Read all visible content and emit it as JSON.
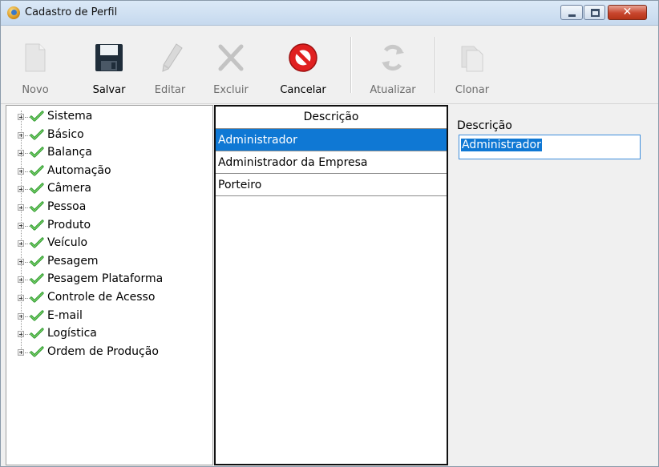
{
  "window": {
    "title": "Cadastro de Perfil",
    "close_glyph": "✕",
    "accent": "#0f78d4"
  },
  "toolbar": {
    "buttons": [
      {
        "label": "Novo",
        "icon": "document-icon",
        "enabled": false
      },
      {
        "label": "Salvar",
        "icon": "floppy-disk-icon",
        "enabled": true
      },
      {
        "label": "Editar",
        "icon": "pencil-icon",
        "enabled": false
      },
      {
        "label": "Excluir",
        "icon": "x-delete-icon",
        "enabled": false
      },
      {
        "label": "Cancelar",
        "icon": "cancel-icon",
        "enabled": true
      },
      {
        "label": "Atualizar",
        "icon": "refresh-icon",
        "enabled": false
      },
      {
        "label": "Clonar",
        "icon": "copy-icon",
        "enabled": false
      }
    ]
  },
  "tree": {
    "items": [
      {
        "label": "Sistema"
      },
      {
        "label": "Básico"
      },
      {
        "label": "Balança"
      },
      {
        "label": "Automação"
      },
      {
        "label": "Câmera"
      },
      {
        "label": "Pessoa"
      },
      {
        "label": "Produto"
      },
      {
        "label": "Veículo"
      },
      {
        "label": "Pesagem"
      },
      {
        "label": "Pesagem Plataforma"
      },
      {
        "label": "Controle de Acesso"
      },
      {
        "label": "E-mail"
      },
      {
        "label": "Logística"
      },
      {
        "label": "Ordem de Produção"
      }
    ]
  },
  "grid": {
    "header": "Descrição",
    "rows": [
      {
        "label": "Administrador",
        "selected": true
      },
      {
        "label": "Administrador da Empresa",
        "selected": false
      },
      {
        "label": "Porteiro",
        "selected": false
      }
    ]
  },
  "form": {
    "descricao_label": "Descrição",
    "descricao_value": "Administrador"
  }
}
